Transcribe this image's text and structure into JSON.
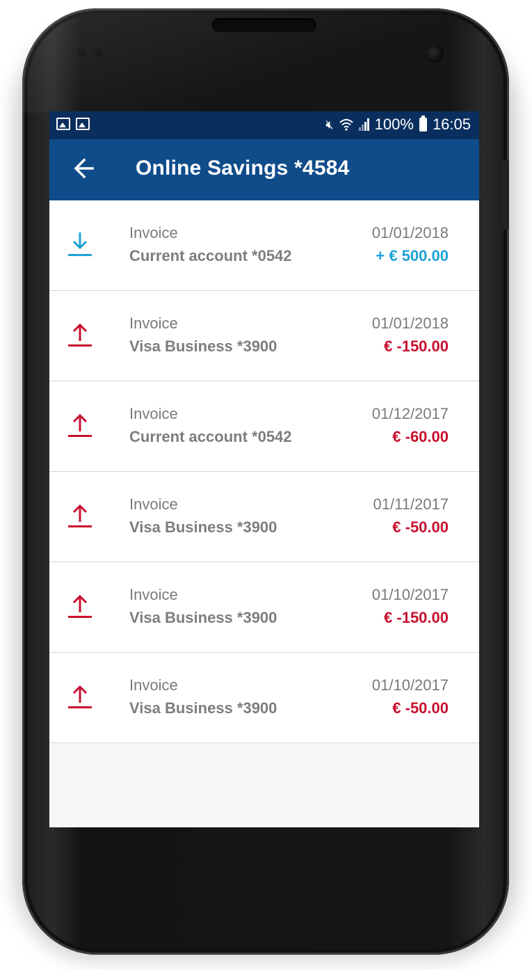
{
  "status_bar": {
    "battery": "100%",
    "time": "16:05"
  },
  "app_bar": {
    "title": "Online Savings *4584",
    "back_icon": "arrow-left-icon"
  },
  "colors": {
    "app_bar": "#0f4c8a",
    "status_bar": "#0a2f5e",
    "incoming": "#1da1d8",
    "outgoing": "#c8102e"
  },
  "transactions": [
    {
      "label": "Invoice",
      "account": "Current account *0542",
      "date": "01/01/2018",
      "amount": "+ € 500.00",
      "direction": "in",
      "icon": "download-icon"
    },
    {
      "label": "Invoice",
      "account": "Visa Business *3900",
      "date": "01/01/2018",
      "amount": "€ -150.00",
      "direction": "out",
      "icon": "upload-icon"
    },
    {
      "label": "Invoice",
      "account": "Current account *0542",
      "date": "01/12/2017",
      "amount": "€ -60.00",
      "direction": "out",
      "icon": "upload-icon"
    },
    {
      "label": "Invoice",
      "account": "Visa Business *3900",
      "date": "01/11/2017",
      "amount": "€ -50.00",
      "direction": "out",
      "icon": "upload-icon"
    },
    {
      "label": "Invoice",
      "account": "Visa Business *3900",
      "date": "01/10/2017",
      "amount": "€ -150.00",
      "direction": "out",
      "icon": "upload-icon"
    },
    {
      "label": "Invoice",
      "account": "Visa Business *3900",
      "date": "01/10/2017",
      "amount": "€ -50.00",
      "direction": "out",
      "icon": "upload-icon"
    }
  ]
}
